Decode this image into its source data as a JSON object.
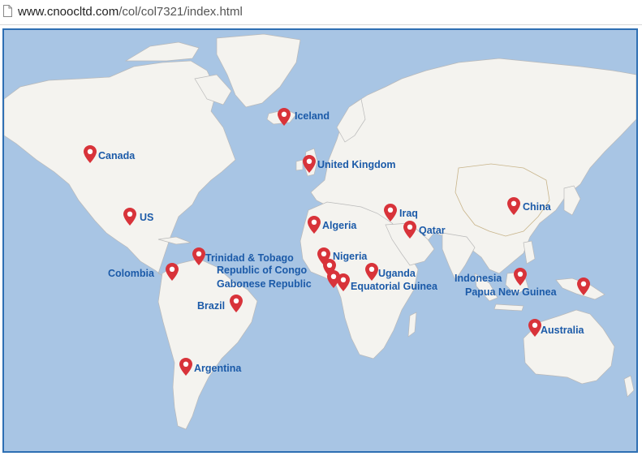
{
  "browser": {
    "url_domain": "www.cnoocltd.com",
    "url_path": "/col/col7321/index.html"
  },
  "map": {
    "colors": {
      "ocean": "#a8c5e4",
      "land": "#f4f3ef",
      "border": "#b9b9b9",
      "marker": "#d8333a",
      "label": "#1b5aa8",
      "frame": "#2e6fb3"
    },
    "locations": [
      {
        "name": "Iceland",
        "marker_icon": "map-pin-icon"
      },
      {
        "name": "Canada",
        "marker_icon": "map-pin-icon"
      },
      {
        "name": "United Kingdom",
        "marker_icon": "map-pin-icon"
      },
      {
        "name": "US",
        "marker_icon": "map-pin-icon"
      },
      {
        "name": "China",
        "marker_icon": "map-pin-icon"
      },
      {
        "name": "Iraq",
        "marker_icon": "map-pin-icon"
      },
      {
        "name": "Algeria",
        "marker_icon": "map-pin-icon"
      },
      {
        "name": "Qatar",
        "marker_icon": "map-pin-icon"
      },
      {
        "name": "Trinidad & Tobago",
        "marker_icon": "map-pin-icon"
      },
      {
        "name": "Nigeria",
        "marker_icon": "map-pin-icon"
      },
      {
        "name": "Republic of Congo",
        "marker_icon": "map-pin-icon"
      },
      {
        "name": "Colombia",
        "marker_icon": "map-pin-icon"
      },
      {
        "name": "Uganda",
        "marker_icon": "map-pin-icon"
      },
      {
        "name": "Indonesia",
        "marker_icon": "map-pin-icon"
      },
      {
        "name": "Gabonese Republic",
        "marker_icon": "map-pin-icon"
      },
      {
        "name": "Equatorial Guinea",
        "marker_icon": "map-pin-icon"
      },
      {
        "name": "Papua New Guinea",
        "marker_icon": "map-pin-icon"
      },
      {
        "name": "Brazil",
        "marker_icon": "map-pin-icon"
      },
      {
        "name": "Australia",
        "marker_icon": "map-pin-icon"
      },
      {
        "name": "Argentina",
        "marker_icon": "map-pin-icon"
      }
    ]
  }
}
